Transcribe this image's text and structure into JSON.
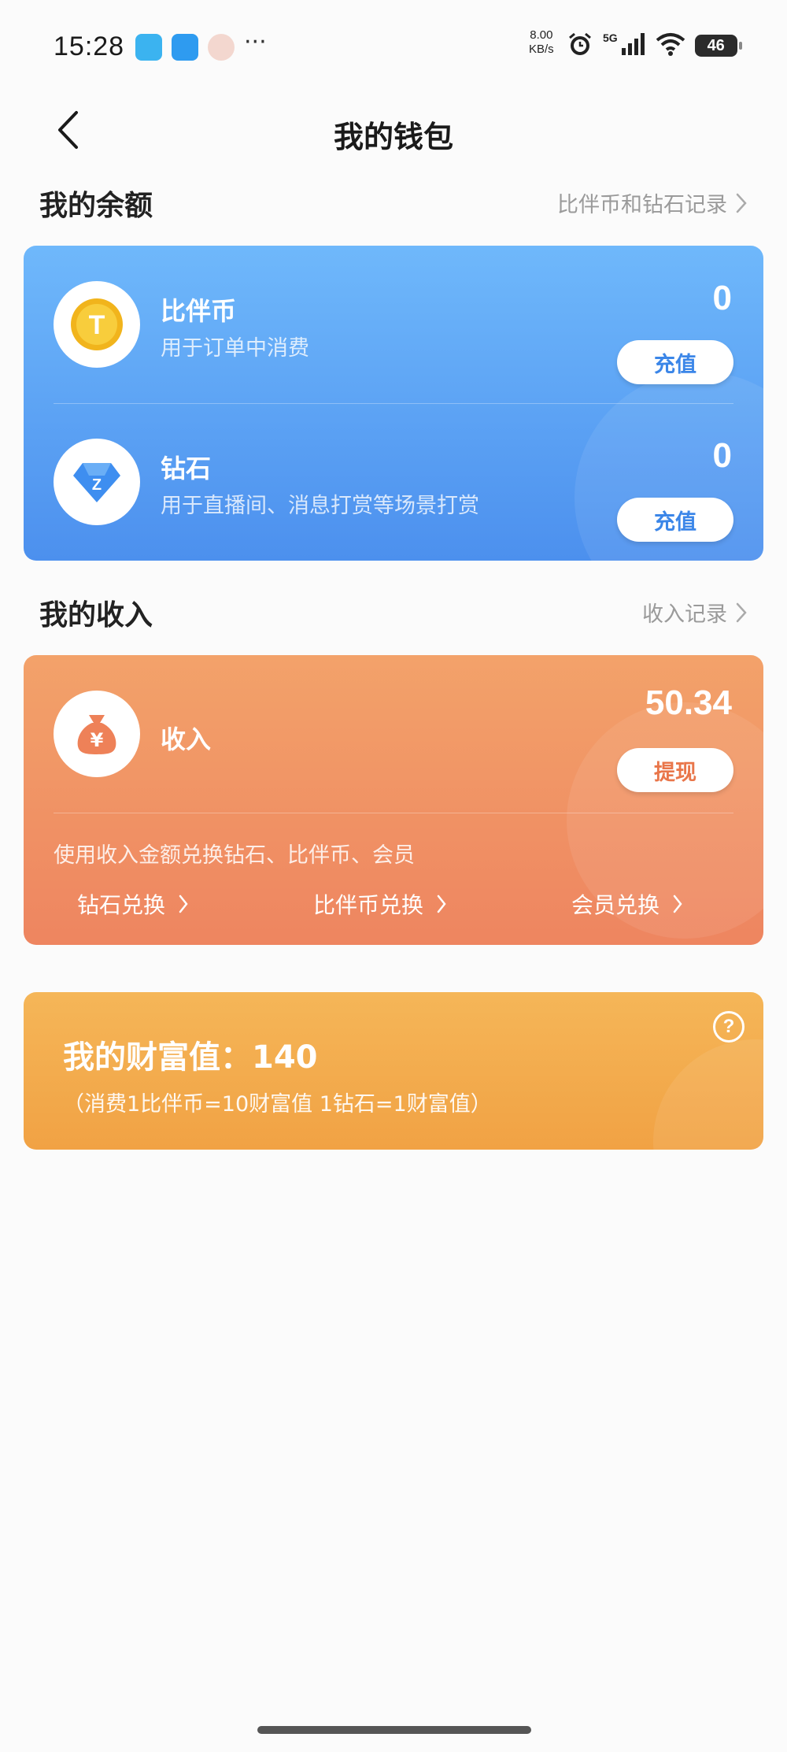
{
  "status_bar": {
    "time": "15:28",
    "more": "···",
    "net_speed_value": "8.00",
    "net_speed_unit": "KB/s",
    "network": "5G",
    "battery": "46"
  },
  "nav": {
    "title": "我的钱包"
  },
  "balance_section": {
    "title": "我的余额",
    "link": "比伴币和钻石记录"
  },
  "coin": {
    "name": "比伴币",
    "desc": "用于订单中消费",
    "value": "0",
    "button": "充值",
    "icon_letter": "T"
  },
  "diamond": {
    "name": "钻石",
    "desc": "用于直播间、消息打赏等场景打赏",
    "value": "0",
    "button": "充值",
    "icon_letter": "Z"
  },
  "income_section": {
    "title": "我的收入",
    "link": "收入记录"
  },
  "income": {
    "name": "收入",
    "value": "50.34",
    "button": "提现",
    "icon_symbol": "¥",
    "hint": "使用收入金额兑换钻石、比伴币、会员",
    "exchange_diamond": "钻石兑换",
    "exchange_coin": "比伴币兑换",
    "exchange_member": "会员兑换"
  },
  "wealth": {
    "title": "我的财富值：140",
    "note": "（消费1比伴币=10财富值 1钻石=1财富值）",
    "help": "?"
  },
  "colors": {
    "balance_gradient_top": "#6fb8fb",
    "balance_gradient_bottom": "#4c90ee",
    "income_gradient_top": "#f3a26a",
    "income_gradient_bottom": "#ee8560",
    "wealth_gradient_top": "#f5b658",
    "wealth_gradient_bottom": "#f1a244",
    "coin_gold": "#f1b41c",
    "diamond_blue": "#3e8ef0",
    "moneybag_orange": "#ee8158"
  }
}
